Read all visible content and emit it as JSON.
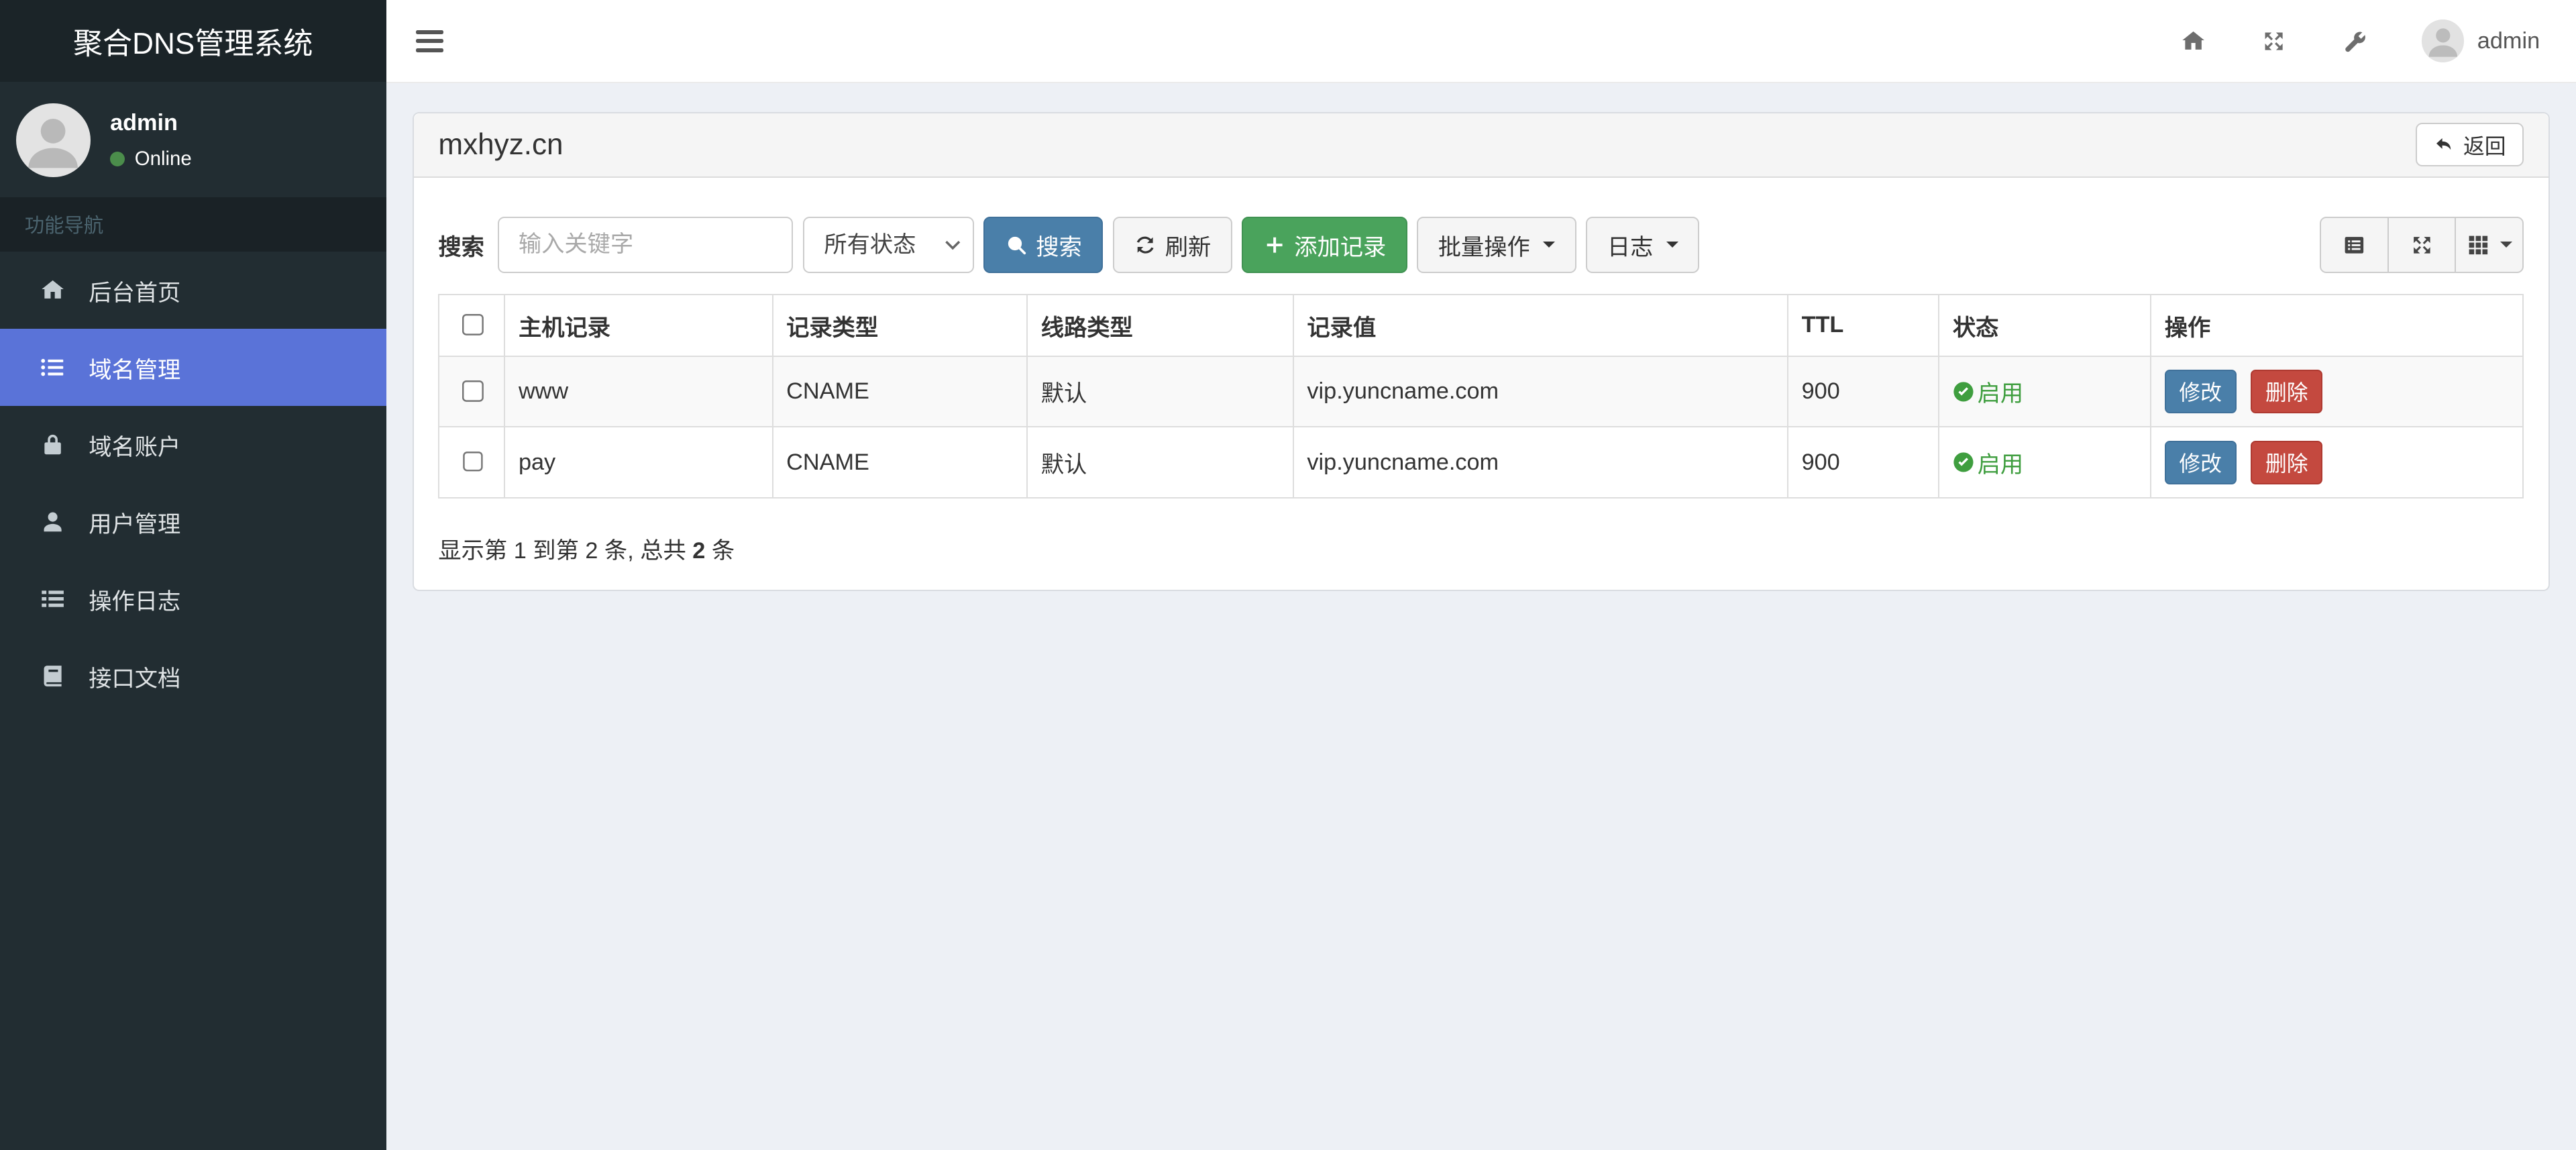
{
  "app_title": "聚合DNS管理系统",
  "navbar": {
    "username": "admin",
    "icons": [
      "menu-icon",
      "home-icon",
      "fullscreen-icon",
      "wrench-icon",
      "avatar"
    ]
  },
  "sidebar": {
    "user": {
      "name": "admin",
      "status": "Online"
    },
    "nav_header": "功能导航",
    "items": [
      {
        "label": "后台首页",
        "icon": "home-icon",
        "active": false
      },
      {
        "label": "域名管理",
        "icon": "list-icon",
        "active": true
      },
      {
        "label": "域名账户",
        "icon": "lock-icon",
        "active": false
      },
      {
        "label": "用户管理",
        "icon": "user-icon",
        "active": false
      },
      {
        "label": "操作日志",
        "icon": "th-list-icon",
        "active": false
      },
      {
        "label": "接口文档",
        "icon": "book-icon",
        "active": false
      }
    ]
  },
  "panel": {
    "title": "mxhyz.cn",
    "back_button": "返回"
  },
  "toolbar": {
    "search_label": "搜索",
    "search_placeholder": "输入关键字",
    "status_filter": "所有状态",
    "search_button": "搜索",
    "refresh_button": "刷新",
    "add_button": "添加记录",
    "batch_button": "批量操作",
    "log_button": "日志",
    "view_icons": [
      "list-alt-icon",
      "fullscreen-icon",
      "columns-icon"
    ]
  },
  "table": {
    "columns": [
      "主机记录",
      "记录类型",
      "线路类型",
      "记录值",
      "TTL",
      "状态",
      "操作"
    ],
    "rows": [
      {
        "host": "www",
        "type": "CNAME",
        "line": "默认",
        "value": "vip.yuncname.com",
        "ttl": "900",
        "status": "启用",
        "edit": "修改",
        "delete": "删除"
      },
      {
        "host": "pay",
        "type": "CNAME",
        "line": "默认",
        "value": "vip.yuncname.com",
        "ttl": "900",
        "status": "启用",
        "edit": "修改",
        "delete": "删除"
      }
    ]
  },
  "pagination": {
    "prefix": "显示第 1 到第 2 条, 总共 ",
    "total": "2",
    "suffix": " 条"
  },
  "colors": {
    "primary_blue": "#4a7fa9",
    "success_green": "#4aa35c",
    "danger_red": "#c4493f",
    "active_nav": "#5a73d8",
    "status_green": "#3f9e3f",
    "sidebar_bg": "#222d32",
    "sidebar_dark": "#1a2226",
    "content_bg": "#edf0f5"
  }
}
